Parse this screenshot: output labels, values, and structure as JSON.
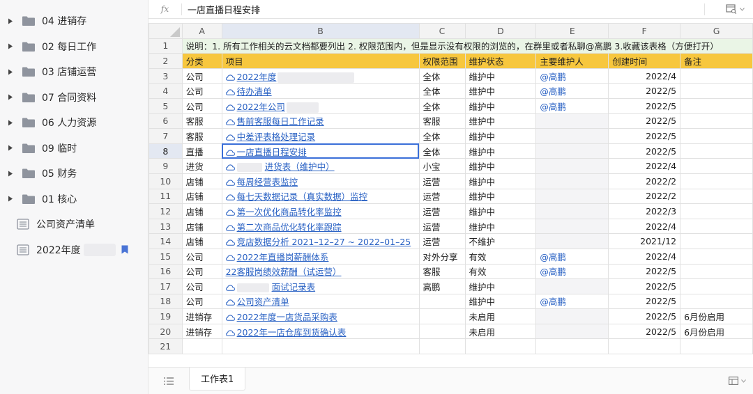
{
  "sidebar": {
    "folders": [
      {
        "label": "04 进销存"
      },
      {
        "label": "02 每日工作"
      },
      {
        "label": "03 店铺运营"
      },
      {
        "label": "07 合同资料"
      },
      {
        "label": "06 人力资源"
      },
      {
        "label": "09 临时"
      },
      {
        "label": "05 财务"
      },
      {
        "label": "01 核心"
      }
    ],
    "docs": [
      {
        "label": "公司资产清单"
      },
      {
        "label": "2022年度"
      }
    ]
  },
  "formula_bar": {
    "fx_label": "fx",
    "value": "一店直播日程安排"
  },
  "grid": {
    "columns": [
      "A",
      "B",
      "C",
      "D",
      "E",
      "F",
      "G"
    ],
    "notice": "说明：1. 所有工作相关的云文档都要列出 2. 权限范围内，但是显示没有权限的浏览的，在群里或者私聊@高鹏 3.收藏该表格（方便打开）",
    "headers": [
      "分类",
      "项目",
      "权限范围",
      "维护状态",
      "主要维护人",
      "创建时间",
      "备注"
    ],
    "rows": [
      {
        "n": "3",
        "a": "公司",
        "b": "2022年度",
        "c": "全体",
        "d": "维护中",
        "e": "@高鹏",
        "f": "2022/4",
        "g": ""
      },
      {
        "n": "4",
        "a": "公司",
        "b": "待办清单",
        "c": "全体",
        "d": "维护中",
        "e": "@高鹏",
        "f": "2022/5",
        "g": ""
      },
      {
        "n": "5",
        "a": "公司",
        "b": "2022年公司",
        "c": "全体",
        "d": "维护中",
        "e": "@高鹏",
        "f": "2022/5",
        "g": ""
      },
      {
        "n": "6",
        "a": "客服",
        "b": "售前客服每日工作记录",
        "c": "客服",
        "d": "维护中",
        "e": "",
        "f": "2022/5",
        "g": ""
      },
      {
        "n": "7",
        "a": "客服",
        "b": "中差评表格处理记录",
        "c": "全体",
        "d": "维护中",
        "e": "",
        "f": "2022/5",
        "g": ""
      },
      {
        "n": "8",
        "a": "直播",
        "b": "一店直播日程安排",
        "c": "全体",
        "d": "维护中",
        "e": "",
        "f": "2022/5",
        "g": ""
      },
      {
        "n": "9",
        "a": "进货",
        "b": "进货表（维护中）",
        "c": "小宝",
        "d": "维护中",
        "e": "",
        "f": "2022/4",
        "g": ""
      },
      {
        "n": "10",
        "a": "店铺",
        "b": "每周经营表监控",
        "c": "运营",
        "d": "维护中",
        "e": "",
        "f": "2022/2",
        "g": ""
      },
      {
        "n": "11",
        "a": "店铺",
        "b": "每七天数据记录（真实数据）监控",
        "c": "运营",
        "d": "维护中",
        "e": "",
        "f": "2022/2",
        "g": ""
      },
      {
        "n": "12",
        "a": "店铺",
        "b": "第一次优化商品转化率监控",
        "c": "运营",
        "d": "维护中",
        "e": "",
        "f": "2022/3",
        "g": ""
      },
      {
        "n": "13",
        "a": "店铺",
        "b": "第二次商品优化转化率跟踪",
        "c": "运营",
        "d": "维护中",
        "e": "",
        "f": "2022/4",
        "g": ""
      },
      {
        "n": "14",
        "a": "店铺",
        "b": "竞店数据分析 2021–12–27 ~ 2022–01–25",
        "c": "运营",
        "d": "不维护",
        "e": "",
        "f": "2021/12",
        "g": ""
      },
      {
        "n": "15",
        "a": "公司",
        "b": "2022年直播岗薪酬体系",
        "c": "对外分享",
        "d": "有效",
        "e": "@高鹏",
        "f": "2022/4",
        "g": ""
      },
      {
        "n": "16",
        "a": "公司",
        "b": "22客服岗绩效薪酬（试运营）",
        "c": "客服",
        "d": "有效",
        "e": "@高鹏",
        "f": "2022/5",
        "g": ""
      },
      {
        "n": "17",
        "a": "公司",
        "b": "面试记录表",
        "c": "高鹏",
        "d": "维护中",
        "e": "",
        "f": "2022/5",
        "g": ""
      },
      {
        "n": "18",
        "a": "公司",
        "b": "公司资产清单",
        "c": "",
        "d": "维护中",
        "e": "@高鹏",
        "f": "2022/5",
        "g": ""
      },
      {
        "n": "19",
        "a": "进销存",
        "b": "2022年度一店货品采购表",
        "c": "",
        "d": "未启用",
        "e": "",
        "f": "2022/5",
        "g": "6月份启用"
      },
      {
        "n": "20",
        "a": "进销存",
        "b": "2022年一店仓库到货确认表",
        "c": "",
        "d": "未启用",
        "e": "",
        "f": "2022/5",
        "g": "6月份启用"
      }
    ],
    "empty_row": "21"
  },
  "sheets": [
    {
      "label": "工作表1"
    }
  ],
  "colors": {
    "accent": "#3a6fd8",
    "header_yellow": "#f7c73e",
    "notice_green": "#eaf5e6",
    "link": "#2a62c4"
  }
}
